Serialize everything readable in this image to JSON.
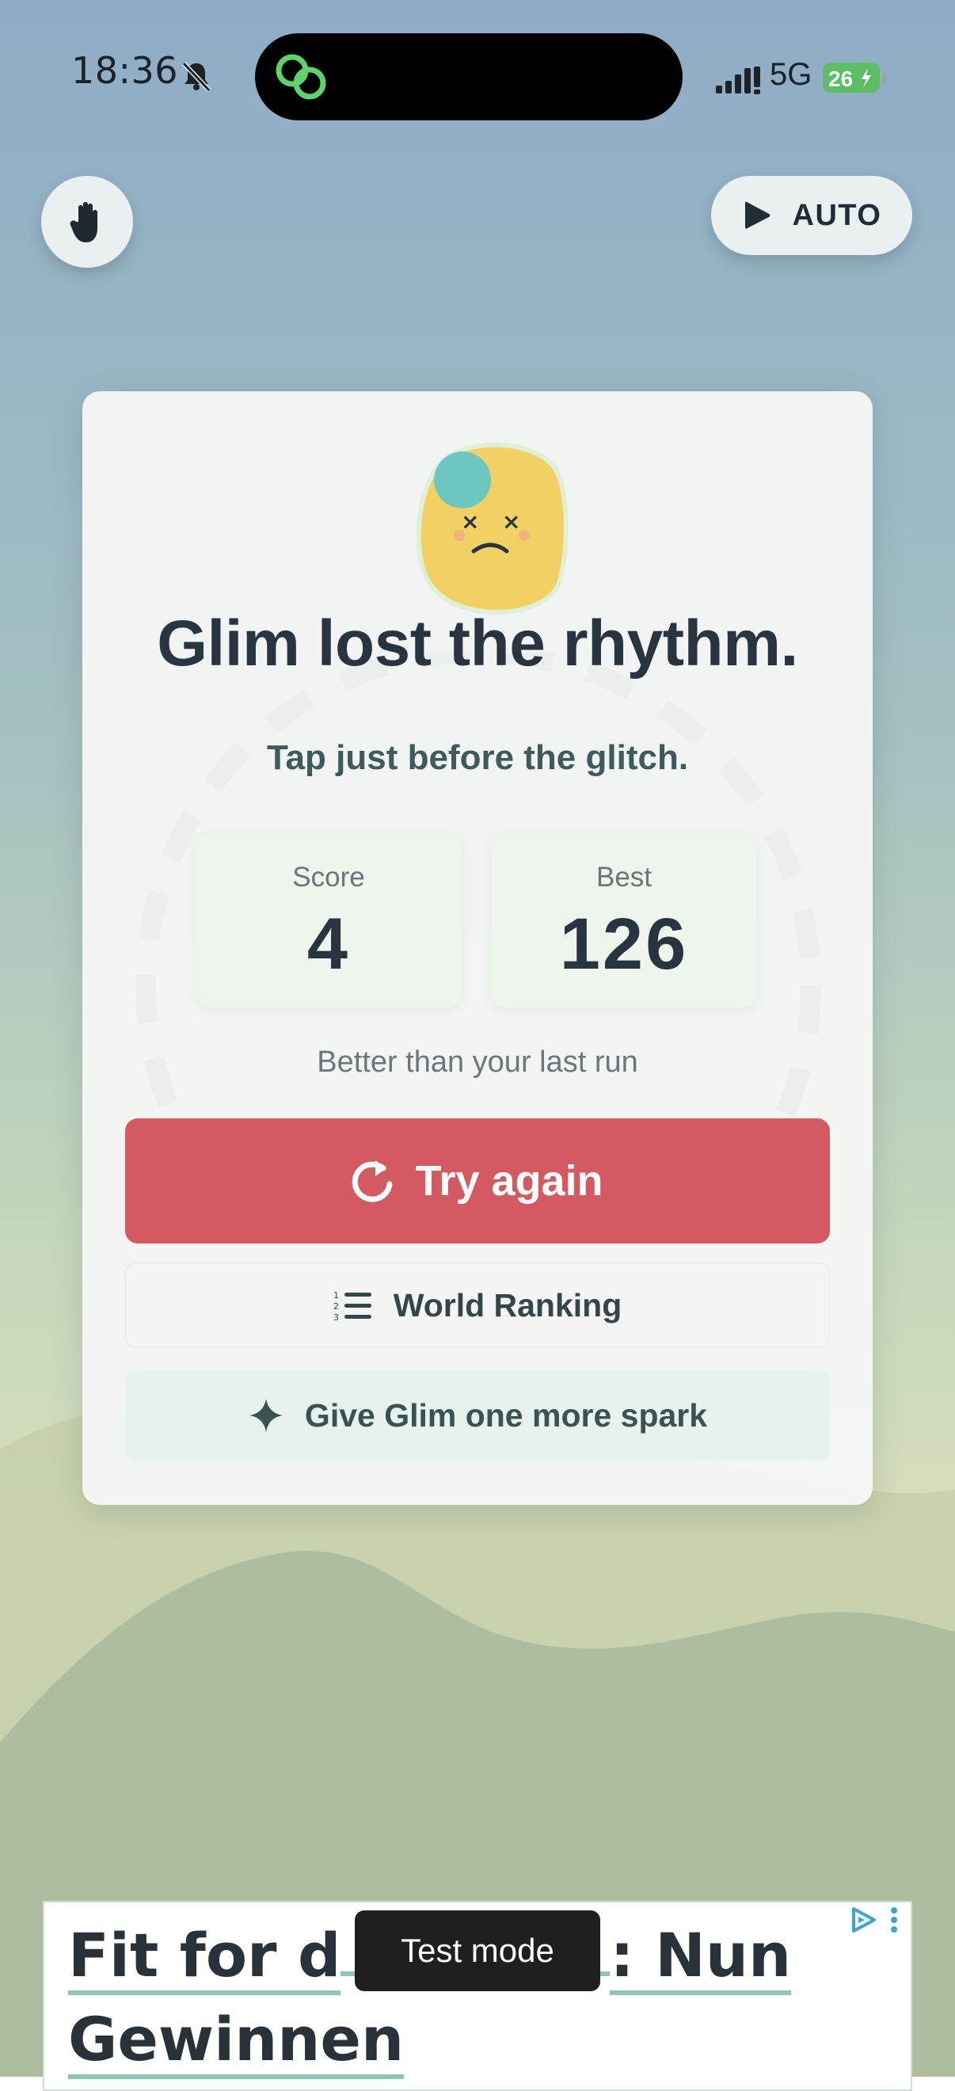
{
  "status_bar": {
    "time": "18:36",
    "network": "5G",
    "battery": "26",
    "icons": [
      "bell-slash-icon",
      "app-link-icon",
      "signal-icon",
      "battery-charging-icon"
    ]
  },
  "top_controls": {
    "hand_button_icon": "hand-icon",
    "auto_label": "AUTO",
    "auto_icon": "play-icon"
  },
  "card": {
    "title": "Glim lost the rhythm.",
    "subtitle": "Tap just before the glitch.",
    "stats": [
      {
        "label": "Score",
        "value": "4"
      },
      {
        "label": "Best",
        "value": "126"
      }
    ],
    "comparison": "Better than your last run",
    "buttons": {
      "try_again": "Try again",
      "world_ranking": "World Ranking",
      "spark": "Give Glim one more spark"
    }
  },
  "ad": {
    "text_line1": "Fit for d",
    "text_line1_end": ": Nun",
    "text_line2": "Gewinnen",
    "icons": [
      "ad-choices-icon",
      "more-vertical-icon"
    ]
  },
  "toast": {
    "label": "Test mode"
  },
  "colors": {
    "primary_button": "#d35a60",
    "title_text": "#28343f",
    "sky_top": "#8eacc6",
    "hills": "#aebd9e"
  }
}
